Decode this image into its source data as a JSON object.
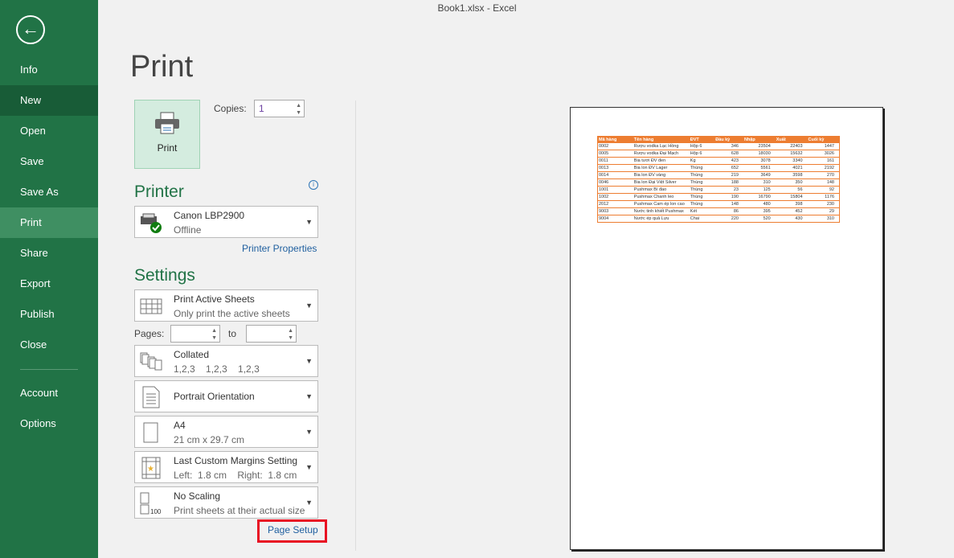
{
  "window_title": "Book1.xlsx - Excel",
  "sidebar": {
    "back": "back-arrow-icon",
    "items": [
      {
        "label": "Info"
      },
      {
        "label": "New"
      },
      {
        "label": "Open"
      },
      {
        "label": "Save"
      },
      {
        "label": "Save As"
      },
      {
        "label": "Print"
      },
      {
        "label": "Share"
      },
      {
        "label": "Export"
      },
      {
        "label": "Publish"
      },
      {
        "label": "Close"
      },
      {
        "label": "Account"
      },
      {
        "label": "Options"
      }
    ],
    "selected": "Print"
  },
  "print": {
    "heading": "Print",
    "button": "Print",
    "copies_label": "Copies:",
    "copies_value": "1"
  },
  "printer": {
    "heading": "Printer",
    "name": "Canon LBP2900",
    "status": "Offline",
    "properties": "Printer Properties"
  },
  "settings": {
    "heading": "Settings",
    "what": {
      "title": "Print Active Sheets",
      "sub": "Only print the active sheets"
    },
    "pages_label": "Pages:",
    "to_label": "to",
    "collate": {
      "title": "Collated",
      "sub": "1,2,3    1,2,3    1,2,3"
    },
    "orientation": {
      "title": "Portrait Orientation"
    },
    "paper": {
      "title": "A4",
      "sub": "21 cm x 29.7 cm"
    },
    "margins": {
      "title": "Last Custom Margins Setting",
      "sub": "Left:  1.8 cm    Right:  1.8 cm"
    },
    "scaling": {
      "title": "No Scaling",
      "sub": "Print sheets at their actual size"
    },
    "page_setup": "Page Setup"
  },
  "preview": {
    "headers": [
      "Mã hàng",
      "Tên hàng",
      "ĐVT",
      "Đầu kỳ",
      "Nhập",
      "Xuất",
      "Cuối kỳ"
    ],
    "rows": [
      [
        "0002",
        "Rượu vodka Lạc Hồng",
        "Hộp 6",
        "346",
        "23504",
        "22403",
        "1447"
      ],
      [
        "0005",
        "Rượu vodka Đại Mạch",
        "Hộp 6",
        "628",
        "18030",
        "15632",
        "3026"
      ],
      [
        "0011",
        "Bia tươi ĐV đen",
        "Kg",
        "423",
        "3078",
        "3340",
        "161"
      ],
      [
        "0013",
        "Bia lon ĐV Lager",
        "Thùng",
        "652",
        "5561",
        "4021",
        "2192"
      ],
      [
        "0014",
        "Bia lon ĐV vàng",
        "Thùng",
        "219",
        "3649",
        "3598",
        "270"
      ],
      [
        "0046",
        "Bia lon Đại Việt Silver",
        "Thùng",
        "188",
        "310",
        "350",
        "148"
      ],
      [
        "1001",
        "Pushmax Bí đao",
        "Thùng",
        "23",
        "125",
        "56",
        "92"
      ],
      [
        "1002",
        "Pushmax Chanh leo",
        "Thùng",
        "190",
        "16790",
        "15804",
        "1176"
      ],
      [
        "2012",
        "Pushmax Cam ép lon cao",
        "Thùng",
        "148",
        "480",
        "398",
        "230"
      ],
      [
        "9003",
        "Nước tinh khiết Pushmax",
        "Két",
        "86",
        "395",
        "452",
        "29"
      ],
      [
        "9004",
        "Nước ép quả Lựu",
        "Chai",
        "220",
        "520",
        "430",
        "310"
      ]
    ]
  },
  "colors": {
    "sidebar": "#217346",
    "accent": "#ed7d31",
    "highlight": "#e81123"
  }
}
